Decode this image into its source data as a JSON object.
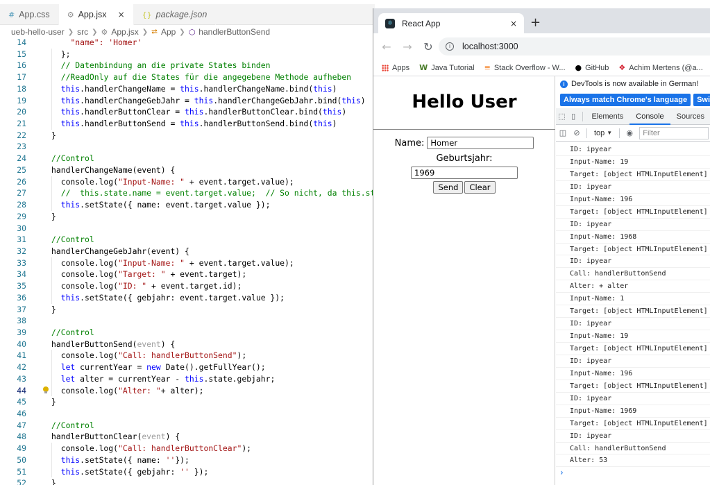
{
  "editor": {
    "tabs": [
      {
        "icon": "#",
        "label": "App.css",
        "active": false
      },
      {
        "icon": "⚙",
        "label": "App.jsx",
        "active": true,
        "close": "×"
      },
      {
        "icon": "{}",
        "label": "package.json",
        "active": false
      }
    ],
    "breadcrumb": {
      "project": "ueb-hello-user",
      "folder": "src",
      "file": "App.jsx",
      "class": "App",
      "method": "handlerButtonSend"
    },
    "current_line": "44",
    "lines": [
      {
        "n": "14",
        "segs": [
          [
            "",
            "    "
          ],
          [
            "str",
            "\"name\": 'Homer'"
          ]
        ]
      },
      {
        "n": "15",
        "segs": [
          [
            "",
            "  };"
          ]
        ]
      },
      {
        "n": "16",
        "segs": [
          [
            "",
            "  "
          ],
          [
            "com",
            "// Datenbindung an die private States binden"
          ]
        ]
      },
      {
        "n": "17",
        "segs": [
          [
            "",
            "  "
          ],
          [
            "com",
            "//ReadOnly auf die States für die angegebene Methode aufheben"
          ]
        ]
      },
      {
        "n": "18",
        "segs": [
          [
            "",
            "  "
          ],
          [
            "kw",
            "this"
          ],
          [
            "",
            ".handlerChangeName = "
          ],
          [
            "kw",
            "this"
          ],
          [
            "",
            ".handlerChangeName.bind("
          ],
          [
            "kw",
            "this"
          ],
          [
            "",
            ")"
          ]
        ]
      },
      {
        "n": "19",
        "segs": [
          [
            "",
            "  "
          ],
          [
            "kw",
            "this"
          ],
          [
            "",
            ".handlerChangeGebJahr = "
          ],
          [
            "kw",
            "this"
          ],
          [
            "",
            ".handlerChangeGebJahr.bind("
          ],
          [
            "kw",
            "this"
          ],
          [
            "",
            ")"
          ]
        ]
      },
      {
        "n": "20",
        "segs": [
          [
            "",
            "  "
          ],
          [
            "kw",
            "this"
          ],
          [
            "",
            ".handlerButtonClear = "
          ],
          [
            "kw",
            "this"
          ],
          [
            "",
            ".handlerButtonClear.bind("
          ],
          [
            "kw",
            "this"
          ],
          [
            "",
            ")"
          ]
        ]
      },
      {
        "n": "21",
        "segs": [
          [
            "",
            "  "
          ],
          [
            "kw",
            "this"
          ],
          [
            "",
            ".handlerButtonSend = "
          ],
          [
            "kw",
            "this"
          ],
          [
            "",
            ".handlerButtonSend.bind("
          ],
          [
            "kw",
            "this"
          ],
          [
            "",
            ")"
          ]
        ]
      },
      {
        "n": "22",
        "segs": [
          [
            "",
            "}"
          ]
        ]
      },
      {
        "n": "23",
        "segs": [
          [
            "",
            ""
          ]
        ]
      },
      {
        "n": "24",
        "segs": [
          [
            "com",
            "//Control"
          ]
        ]
      },
      {
        "n": "25",
        "segs": [
          [
            "",
            "handlerChangeName(event) {"
          ]
        ]
      },
      {
        "n": "26",
        "segs": [
          [
            "",
            "  console.log("
          ],
          [
            "str",
            "\"Input-Name: \""
          ],
          [
            "",
            " + event.target.value);"
          ]
        ]
      },
      {
        "n": "27",
        "segs": [
          [
            "",
            "  "
          ],
          [
            "com",
            "//  this.state.name = event.target.value;  // So nicht, da this.sta"
          ]
        ]
      },
      {
        "n": "28",
        "segs": [
          [
            "",
            "  "
          ],
          [
            "kw",
            "this"
          ],
          [
            "",
            ".setState({ name: event.target.value });"
          ]
        ]
      },
      {
        "n": "29",
        "segs": [
          [
            "",
            "}"
          ]
        ]
      },
      {
        "n": "30",
        "segs": [
          [
            "",
            ""
          ]
        ]
      },
      {
        "n": "31",
        "segs": [
          [
            "com",
            "//Control"
          ]
        ]
      },
      {
        "n": "32",
        "segs": [
          [
            "",
            "handlerChangeGebJahr(event) {"
          ]
        ]
      },
      {
        "n": "33",
        "segs": [
          [
            "",
            "  console.log("
          ],
          [
            "str",
            "\"Input-Name: \""
          ],
          [
            "",
            " + event.target.value);"
          ]
        ]
      },
      {
        "n": "34",
        "segs": [
          [
            "",
            "  console.log("
          ],
          [
            "str",
            "\"Target: \""
          ],
          [
            "",
            " + event.target);"
          ]
        ]
      },
      {
        "n": "35",
        "segs": [
          [
            "",
            "  console.log("
          ],
          [
            "str",
            "\"ID: \""
          ],
          [
            "",
            " + event.target.id);"
          ]
        ]
      },
      {
        "n": "36",
        "segs": [
          [
            "",
            "  "
          ],
          [
            "kw",
            "this"
          ],
          [
            "",
            ".setState({ gebjahr: event.target.value });"
          ]
        ]
      },
      {
        "n": "37",
        "segs": [
          [
            "",
            "}"
          ]
        ]
      },
      {
        "n": "38",
        "segs": [
          [
            "",
            ""
          ]
        ]
      },
      {
        "n": "39",
        "segs": [
          [
            "com",
            "//Control"
          ]
        ]
      },
      {
        "n": "40",
        "segs": [
          [
            "",
            "handlerButtonSend("
          ],
          [
            "par",
            "event"
          ],
          [
            "",
            ") {"
          ]
        ]
      },
      {
        "n": "41",
        "segs": [
          [
            "",
            "  console.log("
          ],
          [
            "str",
            "\"Call: handlerButtonSend\""
          ],
          [
            "",
            ");"
          ]
        ]
      },
      {
        "n": "42",
        "segs": [
          [
            "",
            "  "
          ],
          [
            "kw",
            "let"
          ],
          [
            "",
            " currentYear = "
          ],
          [
            "kw",
            "new"
          ],
          [
            "",
            " Date().getFullYear();"
          ]
        ]
      },
      {
        "n": "43",
        "segs": [
          [
            "",
            "  "
          ],
          [
            "kw",
            "let"
          ],
          [
            "",
            " alter = currentYear - "
          ],
          [
            "kw",
            "this"
          ],
          [
            "",
            ".state.gebjahr;"
          ]
        ]
      },
      {
        "n": "44",
        "segs": [
          [
            "",
            "  console.log("
          ],
          [
            "str",
            "\"Alter: \""
          ],
          [
            "",
            "+ alter);"
          ]
        ]
      },
      {
        "n": "45",
        "segs": [
          [
            "",
            "}"
          ]
        ]
      },
      {
        "n": "46",
        "segs": [
          [
            "",
            ""
          ]
        ]
      },
      {
        "n": "47",
        "segs": [
          [
            "com",
            "//Control"
          ]
        ]
      },
      {
        "n": "48",
        "segs": [
          [
            "",
            "handlerButtonClear("
          ],
          [
            "par",
            "event"
          ],
          [
            "",
            ") {"
          ]
        ]
      },
      {
        "n": "49",
        "segs": [
          [
            "",
            "  console.log("
          ],
          [
            "str",
            "\"Call: handlerButtonClear\""
          ],
          [
            "",
            ");"
          ]
        ]
      },
      {
        "n": "50",
        "segs": [
          [
            "",
            "  "
          ],
          [
            "kw",
            "this"
          ],
          [
            "",
            ".setState({ name: "
          ],
          [
            "str",
            "''"
          ],
          [
            "",
            "});"
          ]
        ]
      },
      {
        "n": "51",
        "segs": [
          [
            "",
            "  "
          ],
          [
            "kw",
            "this"
          ],
          [
            "",
            ".setState({ gebjahr: "
          ],
          [
            "str",
            "''"
          ],
          [
            "",
            " });"
          ]
        ]
      },
      {
        "n": "52",
        "segs": [
          [
            "",
            "}"
          ]
        ]
      }
    ]
  },
  "browser": {
    "tab_title": "React App",
    "tab_close": "×",
    "new_tab": "+",
    "url": "localhost:3000",
    "bookmarks": [
      {
        "icon": "apps",
        "label": "Apps"
      },
      {
        "icon": "W",
        "label": "Java Tutorial"
      },
      {
        "icon": "stack-overflow",
        "label": "Stack Overflow - W..."
      },
      {
        "icon": "github",
        "label": "GitHub"
      },
      {
        "icon": "mertens",
        "label": "Achim Mertens (@a..."
      }
    ],
    "page": {
      "heading": "Hello User",
      "name_label": "Name:",
      "name_value": "Homer",
      "birth_label": "Geburtsjahr:",
      "birth_value": "1969",
      "send_label": "Send",
      "clear_label": "Clear"
    },
    "devtools": {
      "info_text": "DevTools is now available in German!",
      "match_language_button": "Always match Chrome's language",
      "switch_button": "Switch De",
      "tabs": [
        "Elements",
        "Console",
        "Sources"
      ],
      "active_tab": "Console",
      "context": "top",
      "filter_placeholder": "Filter",
      "prompt": "›",
      "log": [
        "ID: ipyear",
        "Input-Name: 19",
        "Target: [object HTMLInputElement]",
        "ID: ipyear",
        "Input-Name: 196",
        "Target: [object HTMLInputElement]",
        "ID: ipyear",
        "Input-Name: 1968",
        "Target: [object HTMLInputElement]",
        "ID: ipyear",
        "Call: handlerButtonSend",
        "Alter: + alter",
        "Input-Name: 1",
        "Target: [object HTMLInputElement]",
        "ID: ipyear",
        "Input-Name: 19",
        "Target: [object HTMLInputElement]",
        "ID: ipyear",
        "Input-Name: 196",
        "Target: [object HTMLInputElement]",
        "ID: ipyear",
        "Input-Name: 1969",
        "Target: [object HTMLInputElement]",
        "ID: ipyear",
        "Call: handlerButtonSend",
        "Alter: 53"
      ]
    }
  }
}
